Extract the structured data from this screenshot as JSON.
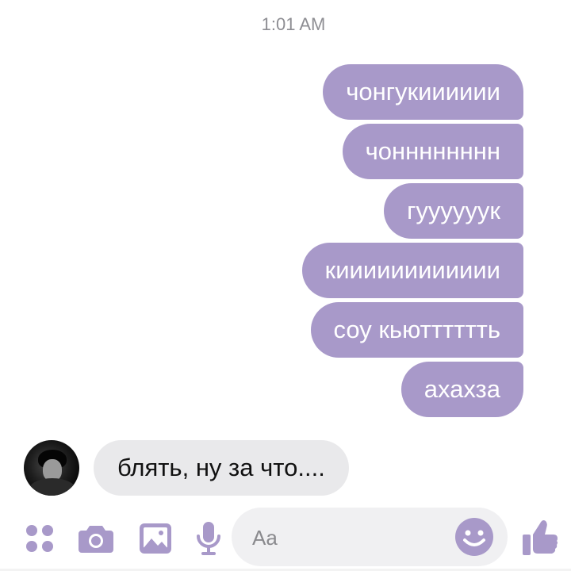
{
  "header": {
    "timestamp": "1:01 AM"
  },
  "outgoing_messages": [
    {
      "text": "чонгукииииии"
    },
    {
      "text": "чонннннннн"
    },
    {
      "text": "гуууууук"
    },
    {
      "text": "кииииииииииии"
    },
    {
      "text": "соу кьютттттть"
    },
    {
      "text": "ахахза"
    }
  ],
  "incoming_message": {
    "text": "блять, ну за что....",
    "avatar": "contact-avatar-photo"
  },
  "composer": {
    "placeholder": "Aa",
    "value": ""
  },
  "toolbar_icons": [
    "apps-icon",
    "camera-icon",
    "image-icon",
    "microphone-icon",
    "emoji-icon",
    "thumbs-up-icon"
  ],
  "colors": {
    "accent": "#a899c9",
    "outgoing_bubble": "#a899c9",
    "incoming_bubble": "#e9e9eb",
    "composer_bg": "#f0f0f2",
    "timestamp": "#8e8e93"
  }
}
